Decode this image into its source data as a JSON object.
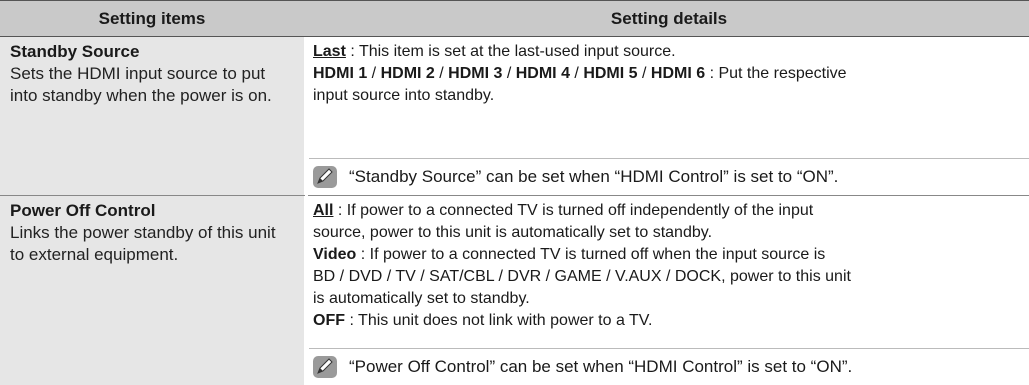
{
  "header": {
    "col1": "Setting items",
    "col2": "Setting details"
  },
  "rows": [
    {
      "title": "Standby Source",
      "description": "Sets the HDMI input source to put into standby when the power is on.",
      "details": {
        "last_label": "Last",
        "last_text": " : This item is set at the last-used input source.",
        "hdmi": [
          "HDMI 1",
          "HDMI 2",
          "HDMI 3",
          "HDMI 4",
          "HDMI 5",
          "HDMI 6"
        ],
        "hdmi_sep": " / ",
        "hdmi_text": " : Put the respective",
        "hdmi_text2": "input source into standby."
      },
      "note": "“Standby Source” can be set when “HDMI Control” is set to “ON”."
    },
    {
      "title": "Power Off Control",
      "description": "Links the power standby of this unit to external equipment.",
      "details": {
        "all_label": "All",
        "all_text1": " : If power to a connected TV is turned off independently of the input",
        "all_text2": "source, power to this unit is automatically set to standby.",
        "video_label": "Video",
        "video_text1": " : If power to a connected TV is turned off when the input source is",
        "video_text2": "BD / DVD / TV / SAT/CBL / DVR / GAME / V.AUX / DOCK, power to this unit",
        "video_text3": "is automatically set to standby.",
        "off_label": "OFF",
        "off_text": " : This unit does not link with power to a TV."
      },
      "note": "“Power Off Control” can be set when “HDMI Control” is set to “ON”."
    }
  ],
  "icons": {
    "note": "pencil-note-icon"
  }
}
